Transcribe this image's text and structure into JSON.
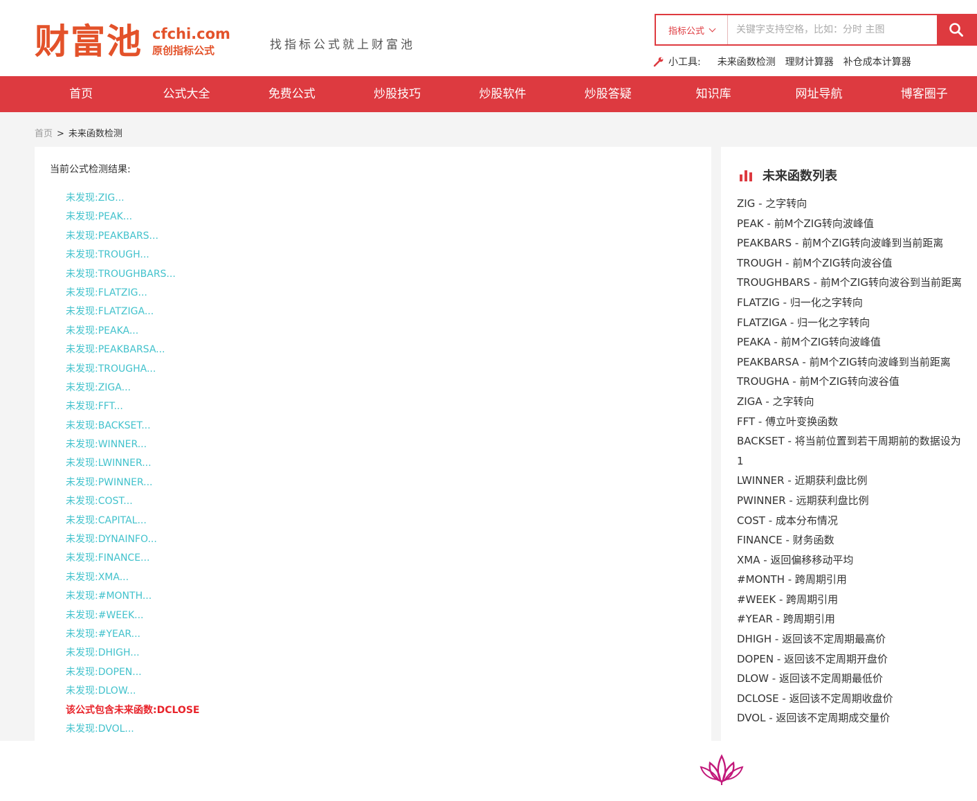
{
  "header": {
    "logo_cn": "财富池",
    "logo_domain": "cfchi.com",
    "logo_sub": "原创指标公式",
    "slogan": "找指标公式就上财富池",
    "search": {
      "category": "指标公式",
      "placeholder": "关键字支持空格，比如：分时 主图",
      "button_icon": "search-icon"
    },
    "tools": {
      "label": "小工具:",
      "links": [
        "未来函数检测",
        "理财计算器",
        "补仓成本计算器"
      ]
    }
  },
  "nav": {
    "items": [
      "首页",
      "公式大全",
      "免费公式",
      "炒股技巧",
      "炒股软件",
      "炒股答疑",
      "知识库",
      "网址导航",
      "博客圈子"
    ]
  },
  "breadcrumb": {
    "home": "首页",
    "separator": ">",
    "current": "未来函数检测"
  },
  "main": {
    "title": "当前公式检测结果:",
    "results": [
      "未发现:ZIG...",
      "未发现:PEAK...",
      "未发现:PEAKBARS...",
      "未发现:TROUGH...",
      "未发现:TROUGHBARS...",
      "未发现:FLATZIG...",
      "未发现:FLATZIGA...",
      "未发现:PEAKA...",
      "未发现:PEAKBARSA...",
      "未发现:TROUGHA...",
      "未发现:ZIGA...",
      "未发现:FFT...",
      "未发现:BACKSET...",
      "未发现:WINNER...",
      "未发现:LWINNER...",
      "未发现:PWINNER...",
      "未发现:COST...",
      "未发现:CAPITAL...",
      "未发现:DYNAINFO...",
      "未发现:FINANCE...",
      "未发现:XMA...",
      "未发现:#MONTH...",
      "未发现:#WEEK...",
      "未发现:#YEAR...",
      "未发现:DHIGH...",
      "未发现:DOPEN...",
      "未发现:DLOW...",
      "该公式包含未来函数:DCLOSE",
      "未发现:DVOL..."
    ],
    "hit_index": 27
  },
  "sidebar": {
    "title": "未来函数列表",
    "items": [
      "ZIG - 之字转向",
      "PEAK - 前M个ZIG转向波峰值",
      "PEAKBARS - 前M个ZIG转向波峰到当前距离",
      "TROUGH - 前M个ZIG转向波谷值",
      "TROUGHBARS - 前M个ZIG转向波谷到当前距离",
      "FLATZIG - 归一化之字转向",
      "FLATZIGA - 归一化之字转向",
      "PEAKA - 前M个ZIG转向波峰值",
      "PEAKBARSA - 前M个ZIG转向波峰到当前距离",
      "TROUGHA - 前M个ZIG转向波谷值",
      "ZIGA - 之字转向",
      "FFT - 傅立叶变换函数",
      "BACKSET - 将当前位置到若干周期前的数据设为1",
      "LWINNER - 近期获利盘比例",
      "PWINNER - 远期获利盘比例",
      "COST - 成本分布情况",
      "FINANCE - 财务函数",
      "XMA - 返回偏移移动平均",
      "#MONTH - 跨周期引用",
      "#WEEK - 跨周期引用",
      "#YEAR - 跨周期引用",
      "DHIGH - 返回该不定周期最高价",
      "DOPEN - 返回该不定周期开盘价",
      "DLOW - 返回该不定周期最低价",
      "DCLOSE - 返回该不定周期收盘价",
      "DVOL - 返回该不定周期成交量价"
    ]
  },
  "colors": {
    "brand_red": "#dd3a40",
    "logo_orange": "#e3522a",
    "result_cyan": "#42c2cc",
    "hit_red": "#e8242b"
  }
}
